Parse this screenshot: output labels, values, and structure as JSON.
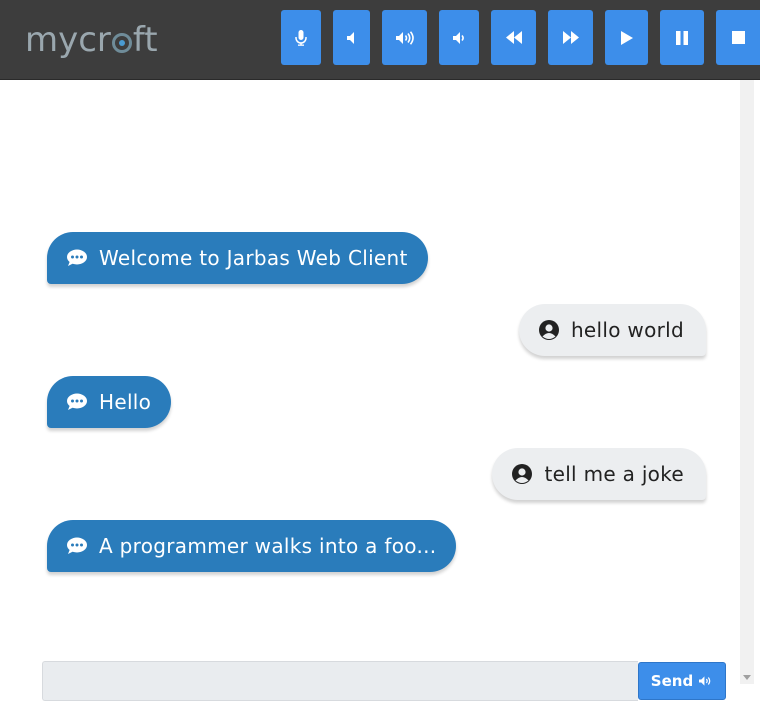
{
  "app": {
    "logo_text_before": "mycr",
    "logo_text_after": "ft"
  },
  "toolbar": {
    "buttons": [
      {
        "icon": "microphone-icon",
        "label": ""
      },
      {
        "icon": "volume-off-icon",
        "label": ""
      },
      {
        "icon": "volume-up-icon",
        "label": ""
      },
      {
        "icon": "volume-down-icon",
        "label": ""
      },
      {
        "icon": "rewind-icon",
        "label": ""
      },
      {
        "icon": "fast-forward-icon",
        "label": ""
      },
      {
        "icon": "play-icon",
        "label": ""
      },
      {
        "icon": "pause-icon",
        "label": ""
      },
      {
        "icon": "stop-icon",
        "label": ""
      }
    ]
  },
  "messages": [
    {
      "sender": "bot",
      "icon": "speech-bubble-icon",
      "text": "Welcome to Jarbas Web Client"
    },
    {
      "sender": "user",
      "icon": "user-circle-icon",
      "text": "hello world"
    },
    {
      "sender": "bot",
      "icon": "speech-bubble-icon",
      "text": "Hello"
    },
    {
      "sender": "user",
      "icon": "user-circle-icon",
      "text": "tell me a joke"
    },
    {
      "sender": "bot",
      "icon": "speech-bubble-icon",
      "text": "A programmer walks into a foo..."
    }
  ],
  "composer": {
    "value": "",
    "placeholder": "",
    "send_label": "Send",
    "send_icon": "volume-up-icon"
  },
  "colors": {
    "topbar": "#3d3d3d",
    "button_accent": "#3d8eea",
    "bot_bubble": "#2a7cbb",
    "user_bubble": "#eceef0"
  }
}
